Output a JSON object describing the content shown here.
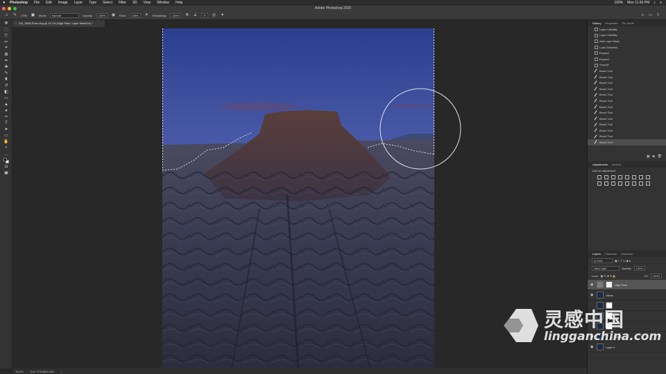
{
  "menubar": {
    "apple": "",
    "items": [
      "Photoshop",
      "File",
      "Edit",
      "Image",
      "Layer",
      "Type",
      "Select",
      "Filter",
      "3D",
      "View",
      "Window",
      "Help"
    ],
    "battery": "100%",
    "clock": "Mon 11:36 PM"
  },
  "window": {
    "title": "Adobe Photoshop 2020"
  },
  "options": {
    "brush_size": "2790",
    "mode_label": "Mode:",
    "mode_value": "Normal",
    "opacity_label": "Opacity:",
    "opacity_value": "100%",
    "flow_label": "Flow:",
    "flow_value": "100%",
    "smoothing_label": "Smoothing:",
    "smoothing_value": "100%",
    "angle_value": "0°"
  },
  "document": {
    "tab_title": "DJI_0095-Pano.dng @ 19.1% (High Pass, Layer Mask/16) *",
    "close": "×"
  },
  "status": {
    "zoom": "16.4%",
    "doc": "Doc: 274.8M/1.96G"
  },
  "history": {
    "tabs": [
      "History",
      "Properties",
      "Pin Panel"
    ],
    "items": [
      "Layer Visibility",
      "Layer Visibility",
      "Add Layer Mask",
      "Load Selection",
      "Expand",
      "Expand",
      "Smooth",
      "Brush Tool",
      "Brush Tool",
      "Brush Tool",
      "Brush Tool",
      "Brush Tool",
      "Brush Tool",
      "Brush Tool",
      "Brush Tool",
      "Brush Tool",
      "Brush Tool",
      "Brush Tool",
      "Brush Tool",
      "Brush Tool"
    ]
  },
  "adjustments": {
    "tabs": [
      "Adjustments",
      "Actions"
    ],
    "add_label": "Add an adjustment"
  },
  "layers": {
    "tabs": [
      "Layers",
      "Channels",
      "Character"
    ],
    "kind": "Q Kind",
    "blend": "Hard Light",
    "opacity_label": "Opacity:",
    "opacity": "100%",
    "lock_label": "Lock:",
    "fill_label": "Fill:",
    "fill": "100%",
    "items": [
      {
        "name": "High Pass"
      },
      {
        "name": "Urban"
      },
      {
        "name": ""
      },
      {
        "name": ""
      },
      {
        "name": ""
      },
      {
        "name": "Ortho"
      },
      {
        "name": "Layer 1"
      }
    ]
  },
  "watermark": {
    "cn": "灵感中国",
    "en": "lingganchina.com"
  }
}
